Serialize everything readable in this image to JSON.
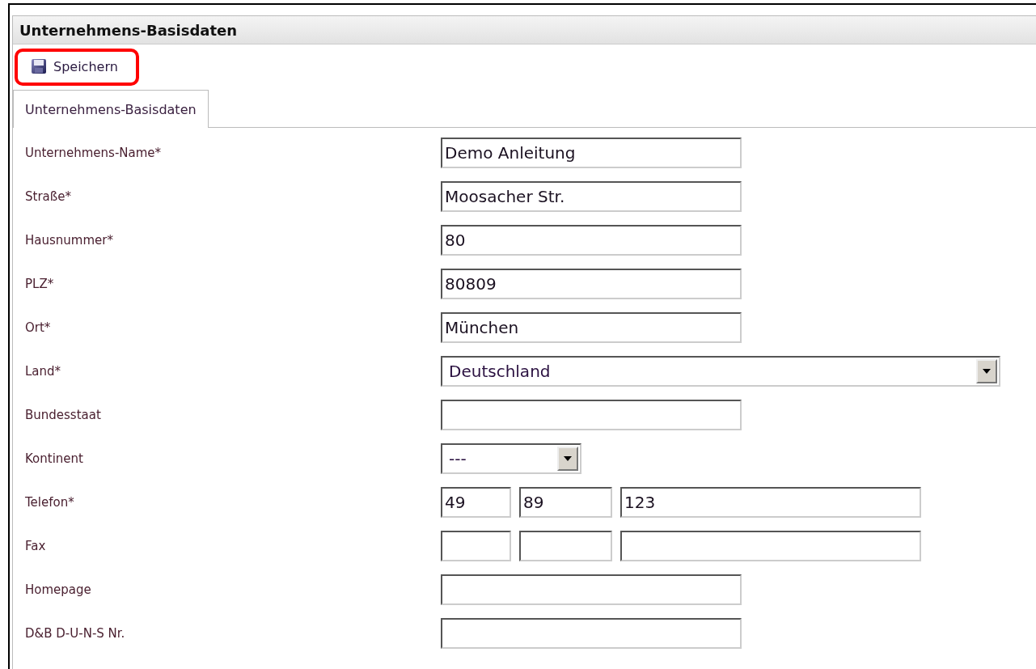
{
  "panel": {
    "title": "Unternehmens-Basisdaten"
  },
  "toolbar": {
    "save_button": {
      "label": "Speichern",
      "highlighted": true
    }
  },
  "tabs": [
    {
      "label": "Unternehmens-Basisdaten",
      "selected": true
    }
  ],
  "form": {
    "rows": [
      {
        "label": "Unternehmens-Name*",
        "kind": "text",
        "values": [
          "Demo Anleitung"
        ]
      },
      {
        "label": "Straße*",
        "kind": "text",
        "values": [
          "Moosacher Str."
        ]
      },
      {
        "label": "Hausnummer*",
        "kind": "text",
        "values": [
          "80"
        ]
      },
      {
        "label": "PLZ*",
        "kind": "text",
        "values": [
          "80809"
        ]
      },
      {
        "label": "Ort*",
        "kind": "text",
        "values": [
          "München"
        ]
      },
      {
        "label": "Land*",
        "kind": "select",
        "values": [
          "Deutschland"
        ]
      },
      {
        "label": "Bundesstaat",
        "kind": "text"
      },
      {
        "label": "Kontinent",
        "kind": "short-select",
        "values": [
          "---"
        ]
      },
      {
        "label": "Telefon*",
        "kind": "phone",
        "values": [
          "49",
          "89",
          "123"
        ]
      },
      {
        "label": "Fax",
        "kind": "phone"
      },
      {
        "label": "Homepage",
        "kind": "text"
      },
      {
        "label": "D&B D-U-N-S Nr.",
        "kind": "text"
      }
    ]
  }
}
